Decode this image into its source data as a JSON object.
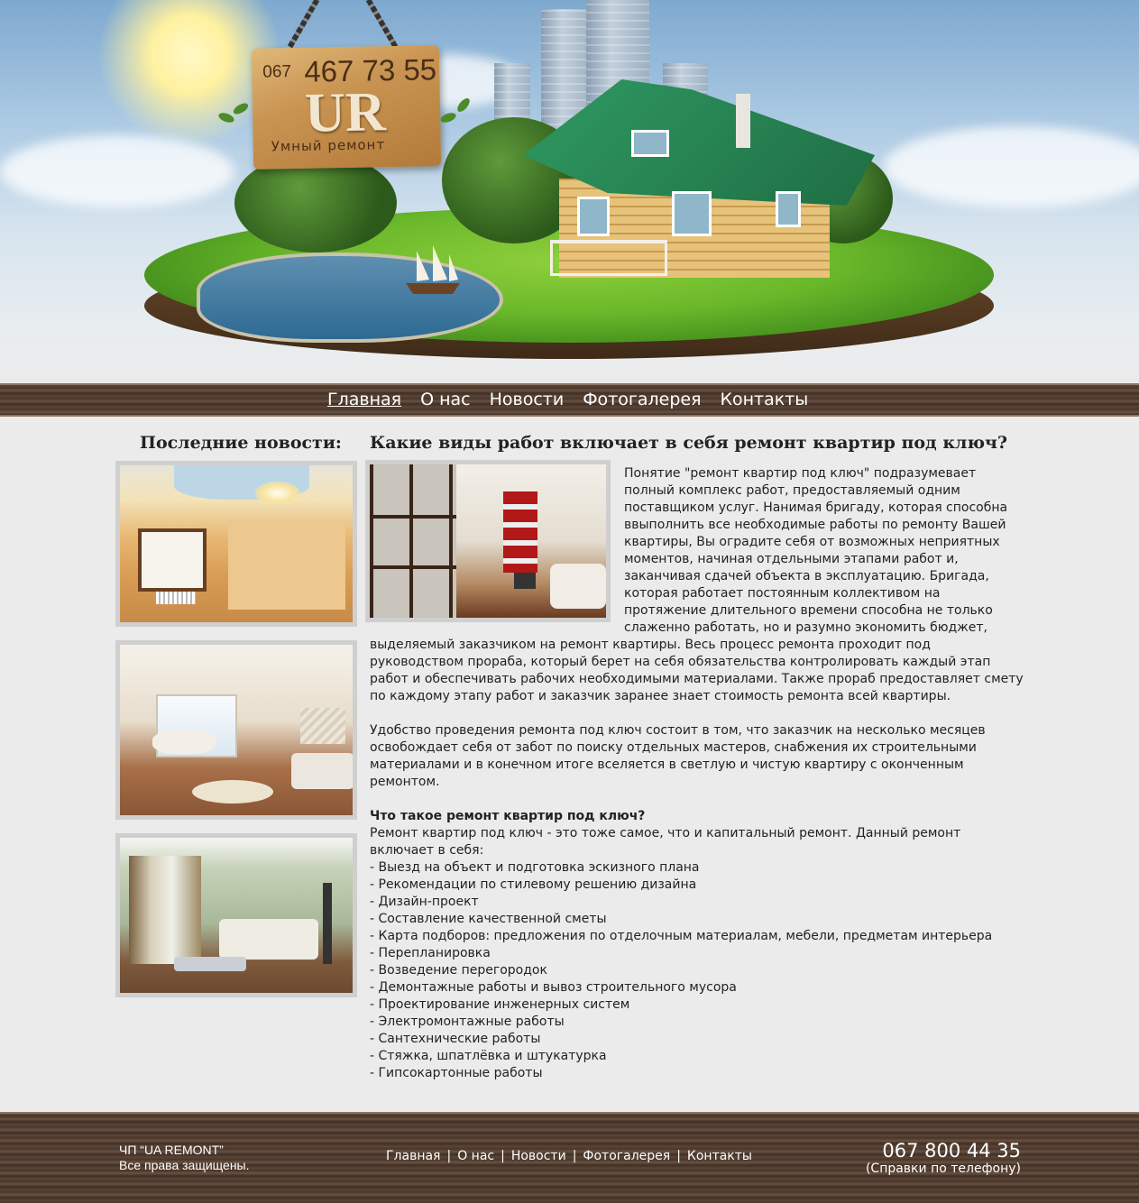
{
  "header": {
    "sign_phone_prefix": "067",
    "sign_phone_number": "467 73 55",
    "logo_letters": "UR",
    "tagline": "Умный ремонт"
  },
  "nav": {
    "items": [
      {
        "label": "Главная",
        "active": true
      },
      {
        "label": "О нас"
      },
      {
        "label": "Новости"
      },
      {
        "label": "Фотогалерея"
      },
      {
        "label": "Контакты"
      }
    ]
  },
  "sidebar": {
    "title": "Последние новости:"
  },
  "article": {
    "title": "Какие виды работ включает в себя ремонт квартир под ключ?",
    "paragraph1": "Понятие \"ремонт квартир под ключ\" подразумевает полный комплекс работ, предоставляемый одним поставщиком услуг. Нанимая бригаду, которая способна ввыполнить все необходимые работы по ремонту Вашей квартиры, Вы оградите себя от возможных неприятных моментов, начиная отдельными этапами работ и, заканчивая сдачей объекта в эксплуатацию. Бригада, которая работает постоянным коллективом на протяжение длительного времени способна не только слаженно работать, но и разумно экономить бюджет, выделяемый заказчиком на ремонт квартиры. Весь процесс ремонта проходит под руководством прораба, который берет на себя обязательства контролировать каждый этап работ и обеспечивать рабочих необходимыми материалами. Также прораб предоставляет смету по каждому этапу работ и заказчик заранее знает стоимость ремонта всей квартиры.",
    "paragraph2": "Удобство проведения ремонта под ключ состоит в том, что заказчик на несколько месяцев освобождает себя от забот по поиску отдельных мастеров, снабжения их строительными материалами и в конечном итоге вселяется в светлую и чистую квартиру с оконченным ремонтом.",
    "question_title": "Что такое ремонт квартир под ключ?",
    "question_intro": "Ремонт квартир под ключ - это тоже самое, что и капитальный ремонт. Данный ремонт включает в себя:",
    "list": [
      "- Выезд на объект и подготовка эскизного плана",
      "- Рекомендации по стилевому решению дизайна",
      "- Дизайн-проект",
      "- Составление качественной сметы",
      "- Карта подборов: предложения по отделочным материалам, мебели, предметам интерьера",
      "- Перепланировка",
      "- Возведение перегородок",
      "- Демонтажные работы и вывоз строительного мусора",
      "- Проектирование инженерных систем",
      "- Электромонтажные работы",
      "- Сантехнические работы",
      "- Стяжка, шпатлёвка и штукатурка",
      "- Гипсокартонные работы"
    ]
  },
  "footer": {
    "company": "ЧП “UA REMONT”",
    "rights": "Все права защищены.",
    "nav": [
      "Главная",
      "О нас",
      "Новости",
      "Фотогалерея",
      "Контакты"
    ],
    "separator": "|",
    "phone": "067 800 44 35",
    "phone_note": "(Справки по телефону)"
  },
  "colors": {
    "page_bg": "#ecebeb",
    "wood_dark": "#4a372a",
    "roof_green": "#1f6e44",
    "grass_green": "#6ab82a"
  }
}
